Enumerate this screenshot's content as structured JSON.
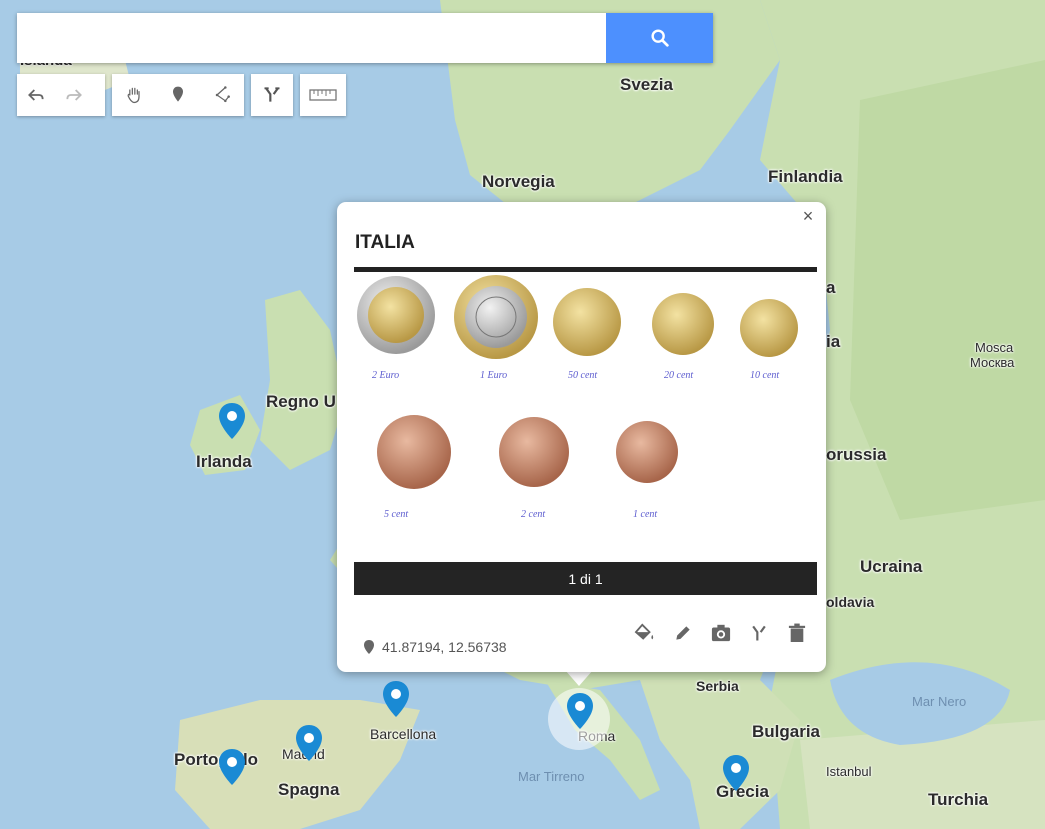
{
  "search": {
    "placeholder": "",
    "value": ""
  },
  "toolbar": {
    "undo_icon": "undo-icon",
    "redo_icon": "redo-icon",
    "pan_icon": "hand-icon",
    "marker_icon": "marker-icon",
    "line_icon": "draw-line-icon",
    "route_icon": "directions-icon",
    "measure_icon": "ruler-icon"
  },
  "map_labels": {
    "islanda": "Islanda",
    "svezia": "Svezia",
    "norvegia": "Norvegia",
    "finlandia": "Finlandia",
    "regno_unito": "Regno U",
    "irlanda": "Irlanda",
    "mosca": "Mosca",
    "mosca_cyr": "Москва",
    "bielorussia": "orussia",
    "ucraina": "Ucraina",
    "moldavia": "oldavia",
    "serbia": "Serbia",
    "bulgaria": "Bulgaria",
    "mar_nero": "Mar Nero",
    "istanbul": "Istanbul",
    "turchia": "Turchia",
    "grecia": "Grecia",
    "mar_tirreno": "Mar Tirreno",
    "roma": "Roma",
    "barcellona": "Barcellona",
    "madrid": "Madrid",
    "spagna": "Spagna",
    "portogallo": "Portogallo",
    "fragment_a": "a",
    "fragment_ia": "ia"
  },
  "infowindow": {
    "title": "ITALIA",
    "close": "×",
    "caption": "1 di 1",
    "coords": "41.87194, 12.56738",
    "coins": [
      {
        "label": "2 Euro"
      },
      {
        "label": "1 Euro"
      },
      {
        "label": "50 cent"
      },
      {
        "label": "20 cent"
      },
      {
        "label": "10 cent"
      },
      {
        "label": "5 cent"
      },
      {
        "label": "2 cent"
      },
      {
        "label": "1 cent"
      }
    ]
  },
  "colors": {
    "sea": "#a7cbe6",
    "land": "#c9dfb1",
    "land_alt": "#e6e4d4",
    "accent": "#4d90fe",
    "pin": "#1a8ad4"
  }
}
